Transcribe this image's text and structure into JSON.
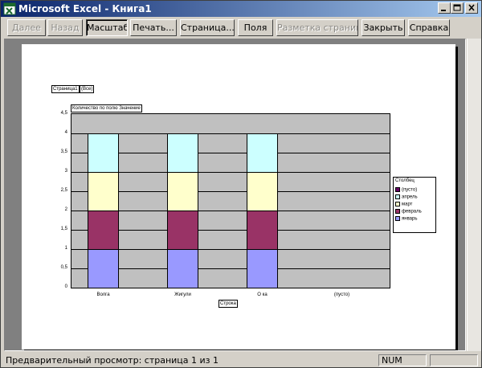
{
  "window": {
    "title": "Microsoft Excel - Книга1",
    "icon": "excel-icon"
  },
  "toolbar": {
    "buttons": [
      {
        "label": "Далее",
        "enabled": false
      },
      {
        "label": "Назад",
        "enabled": false
      },
      {
        "label": "Масштаб",
        "enabled": true,
        "pressed": true
      },
      {
        "label": "Печать...",
        "enabled": true
      },
      {
        "label": "Страница...",
        "enabled": true
      },
      {
        "label": "Поля",
        "enabled": true
      },
      {
        "label": "Разметка страницы",
        "enabled": false
      },
      {
        "label": "Закрыть",
        "enabled": true
      },
      {
        "label": "Справка",
        "enabled": true
      }
    ]
  },
  "sheet": {
    "page_field": "Страница1",
    "page_field_value": "(Все)",
    "data_field": "Количество по полю Значение",
    "row_field": "Строка",
    "column_field": "Столбец"
  },
  "chart_data": {
    "type": "bar",
    "stacked": true,
    "categories": [
      "Волга",
      "Жигули",
      "О ка",
      "(пусто)"
    ],
    "series": [
      {
        "name": "январь",
        "color": "#9999ff",
        "values": [
          1,
          1,
          1,
          0
        ]
      },
      {
        "name": "февраль",
        "color": "#993366",
        "values": [
          1,
          1,
          1,
          0
        ]
      },
      {
        "name": "март",
        "color": "#ffffcc",
        "values": [
          1,
          1,
          1,
          0
        ]
      },
      {
        "name": "апрель",
        "color": "#ccffff",
        "values": [
          1,
          1,
          1,
          0
        ]
      },
      {
        "name": "(пусто)",
        "color": "#660066",
        "values": [
          0,
          0,
          0,
          0
        ]
      }
    ],
    "legend_order": [
      "(пусто)",
      "апрель",
      "март",
      "февраль",
      "январь"
    ],
    "legend_title": "Столбец",
    "legend_position": "right",
    "y_ticks": [
      "0",
      "0,5",
      "1",
      "1,5",
      "2",
      "2,5",
      "3",
      "3,5",
      "4",
      "4,5"
    ],
    "ylim": [
      0,
      4.5
    ],
    "xlabel": "Строка",
    "plot_background": "#c0c0c0",
    "grid": true
  },
  "status": {
    "text": "Предварительный просмотр: страница 1 из 1",
    "num": "NUM"
  }
}
